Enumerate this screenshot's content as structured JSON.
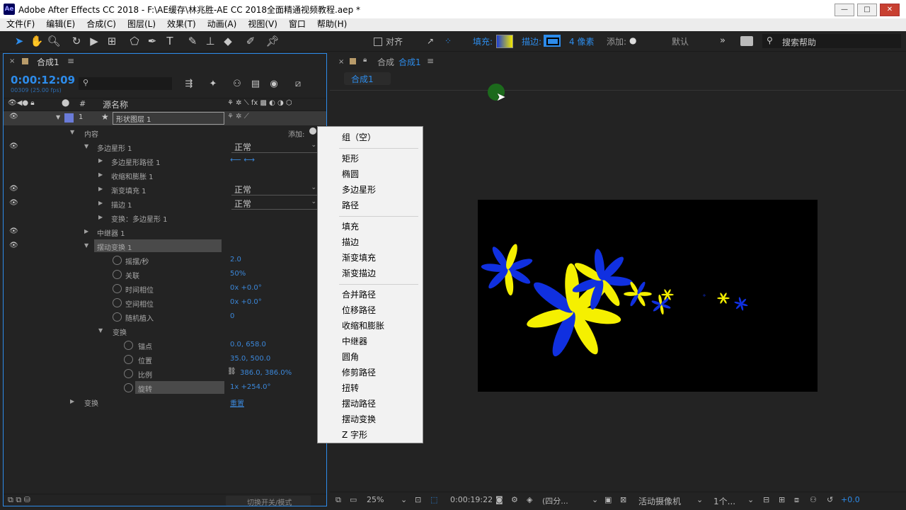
{
  "window": {
    "title": "Adobe After Effects CC 2018 - F:\\AE缓存\\林兆胜-AE CC 2018全面精通视频教程.aep *",
    "app_icon": "Ae",
    "minimize": "—",
    "maximize": "□",
    "close": "✕"
  },
  "menu": [
    "文件(F)",
    "编辑(E)",
    "合成(C)",
    "图层(L)",
    "效果(T)",
    "动画(A)",
    "视图(V)",
    "窗口",
    "帮助(H)"
  ],
  "toolbar": {
    "align_label": "对齐",
    "fill_label": "填充:",
    "stroke_label": "描边:",
    "stroke_width": "4 像素",
    "add_label": "添加:",
    "workspace": "默认",
    "search_placeholder": "搜索帮助"
  },
  "timeline": {
    "tab": "合成1",
    "timecode": "0:00:12:09",
    "frame_info": "00309 (25.00 fps)",
    "search_icon": "search-icon",
    "col_index": "#",
    "col_source": "源名称",
    "layer": {
      "index": "1",
      "name": "形状图层 1"
    },
    "contents_label": "内容",
    "add_label": "添加:",
    "footer_label": "切换开关/模式",
    "rows": [
      {
        "label": "多边星形 1",
        "dropdown": "正常"
      },
      {
        "label": "多边星形路径 1"
      },
      {
        "label": "收缩和膨胀 1"
      },
      {
        "label": "渐变填充 1",
        "dropdown": "正常"
      },
      {
        "label": "描边 1",
        "dropdown": "正常"
      },
      {
        "label": "变换：多边星形 1"
      },
      {
        "label": "中继器 1"
      },
      {
        "label": "摆动变换 1"
      }
    ],
    "wiggle_props": [
      {
        "label": "摇摆/秒",
        "value": "2.0"
      },
      {
        "label": "关联",
        "value": "50%"
      },
      {
        "label": "时间相位",
        "value": "0x +0.0°"
      },
      {
        "label": "空间相位",
        "value": "0x +0.0°"
      },
      {
        "label": "随机植入",
        "value": "0"
      }
    ],
    "transform_label": "变换",
    "transform_props": [
      {
        "label": "锚点",
        "value": "0.0, 658.0"
      },
      {
        "label": "位置",
        "value": "35.0, 500.0"
      },
      {
        "label": "比例",
        "value": "386.0, 386.0%"
      },
      {
        "label": "旋转",
        "value": "1x +254.0°"
      }
    ],
    "outer_transform": {
      "label": "变换",
      "value": "重置"
    }
  },
  "context_menu": {
    "groups": [
      [
        "组（空）"
      ],
      [
        "矩形",
        "椭圆",
        "多边星形",
        "路径"
      ],
      [
        "填充",
        "描边",
        "渐变填充",
        "渐变描边"
      ],
      [
        "合并路径",
        "位移路径",
        "收缩和膨胀",
        "中继器",
        "圆角",
        "修剪路径",
        "扭转",
        "摆动路径",
        "摆动变换",
        "Z 字形"
      ]
    ]
  },
  "composition": {
    "panel_label": "合成",
    "comp_name": "合成1",
    "comp_tab": "合成1",
    "cursor_color": "#1c6a1c"
  },
  "viewer_footer": {
    "zoom": "25%",
    "timecode": "0:00:19:22",
    "resolution": "(四分...",
    "camera": "活动摄像机",
    "views": "1个...",
    "exposure": "+0.0"
  },
  "colors": {
    "accent": "#2d8ceb",
    "petal_blue": "#1030e0",
    "petal_yellow": "#f5f000",
    "layer_label": "#6a7bd8"
  }
}
